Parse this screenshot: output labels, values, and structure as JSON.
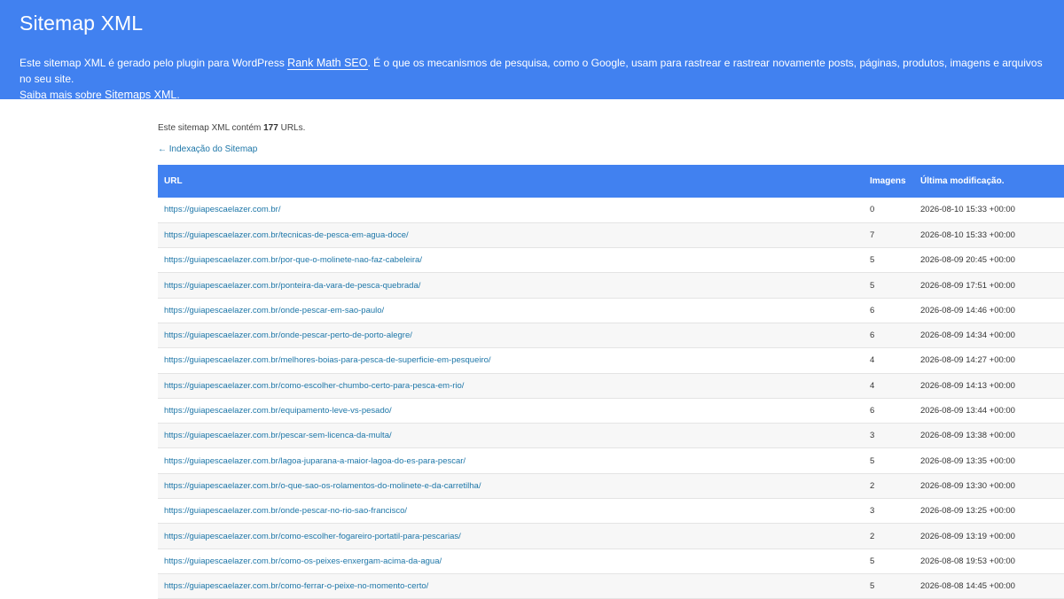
{
  "header": {
    "title": "Sitemap XML",
    "desc_part1": "Este sitemap XML é gerado pelo plugin para WordPress ",
    "desc_link1": "Rank Math SEO",
    "desc_part2": ". É o que os mecanismos de pesquisa, como o Google, usam para rastrear e rastrear novamente posts, páginas, produtos, imagens e arquivos no seu site.",
    "desc_part3": "Saiba mais sobre ",
    "desc_link2": "Sitemaps XML",
    "desc_part4": "."
  },
  "intro": {
    "prefix": "Este sitemap XML contém ",
    "count": "177",
    "suffix": " URLs."
  },
  "back_link": "← Indexação do Sitemap",
  "table": {
    "headers": {
      "url": "URL",
      "images": "Imagens",
      "modified": "Última modificação."
    },
    "rows": [
      {
        "url": "https://guiapescaelazer.com.br/",
        "images": "0",
        "modified": "2026-08-10 15:33 +00:00"
      },
      {
        "url": "https://guiapescaelazer.com.br/tecnicas-de-pesca-em-agua-doce/",
        "images": "7",
        "modified": "2026-08-10 15:33 +00:00"
      },
      {
        "url": "https://guiapescaelazer.com.br/por-que-o-molinete-nao-faz-cabeleira/",
        "images": "5",
        "modified": "2026-08-09 20:45 +00:00"
      },
      {
        "url": "https://guiapescaelazer.com.br/ponteira-da-vara-de-pesca-quebrada/",
        "images": "5",
        "modified": "2026-08-09 17:51 +00:00"
      },
      {
        "url": "https://guiapescaelazer.com.br/onde-pescar-em-sao-paulo/",
        "images": "6",
        "modified": "2026-08-09 14:46 +00:00"
      },
      {
        "url": "https://guiapescaelazer.com.br/onde-pescar-perto-de-porto-alegre/",
        "images": "6",
        "modified": "2026-08-09 14:34 +00:00"
      },
      {
        "url": "https://guiapescaelazer.com.br/melhores-boias-para-pesca-de-superficie-em-pesqueiro/",
        "images": "4",
        "modified": "2026-08-09 14:27 +00:00"
      },
      {
        "url": "https://guiapescaelazer.com.br/como-escolher-chumbo-certo-para-pesca-em-rio/",
        "images": "4",
        "modified": "2026-08-09 14:13 +00:00"
      },
      {
        "url": "https://guiapescaelazer.com.br/equipamento-leve-vs-pesado/",
        "images": "6",
        "modified": "2026-08-09 13:44 +00:00"
      },
      {
        "url": "https://guiapescaelazer.com.br/pescar-sem-licenca-da-multa/",
        "images": "3",
        "modified": "2026-08-09 13:38 +00:00"
      },
      {
        "url": "https://guiapescaelazer.com.br/lagoa-juparana-a-maior-lagoa-do-es-para-pescar/",
        "images": "5",
        "modified": "2026-08-09 13:35 +00:00"
      },
      {
        "url": "https://guiapescaelazer.com.br/o-que-sao-os-rolamentos-do-molinete-e-da-carretilha/",
        "images": "2",
        "modified": "2026-08-09 13:30 +00:00"
      },
      {
        "url": "https://guiapescaelazer.com.br/onde-pescar-no-rio-sao-francisco/",
        "images": "3",
        "modified": "2026-08-09 13:25 +00:00"
      },
      {
        "url": "https://guiapescaelazer.com.br/como-escolher-fogareiro-portatil-para-pescarias/",
        "images": "2",
        "modified": "2026-08-09 13:19 +00:00"
      },
      {
        "url": "https://guiapescaelazer.com.br/como-os-peixes-enxergam-acima-da-agua/",
        "images": "5",
        "modified": "2026-08-08 19:53 +00:00"
      },
      {
        "url": "https://guiapescaelazer.com.br/como-ferrar-o-peixe-no-momento-certo/",
        "images": "5",
        "modified": "2026-08-08 14:45 +00:00"
      }
    ]
  }
}
